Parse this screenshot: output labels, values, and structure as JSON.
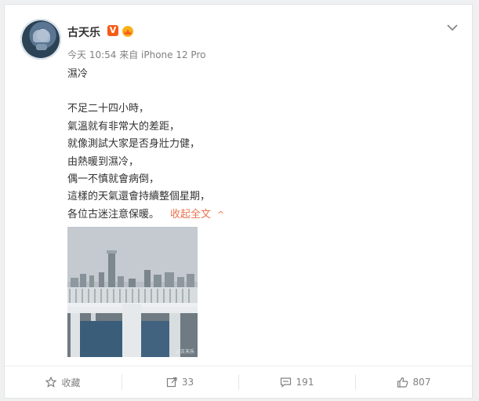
{
  "post": {
    "user": {
      "name": "古天乐",
      "vip_label": "V"
    },
    "meta": "今天 10:54 来自 iPhone 12 Pro",
    "content": {
      "title": "濕冷",
      "lines": [
        "不足二十四小時，",
        "氣溫就有非常大的差距，",
        "就像測試大家是否身壯力健，",
        "由熱暖到濕冷，",
        "偶一不慎就會病倒，",
        "這樣的天氣還會持續整個星期，",
        "各位古迷注意保暖。"
      ],
      "collapse_label": "收起全文",
      "collapse_caret": "^"
    },
    "image": {
      "watermark": "@古天乐"
    },
    "actions": {
      "favorite_label": "收藏",
      "repost_count": "33",
      "comment_count": "191",
      "like_count": "807"
    }
  }
}
